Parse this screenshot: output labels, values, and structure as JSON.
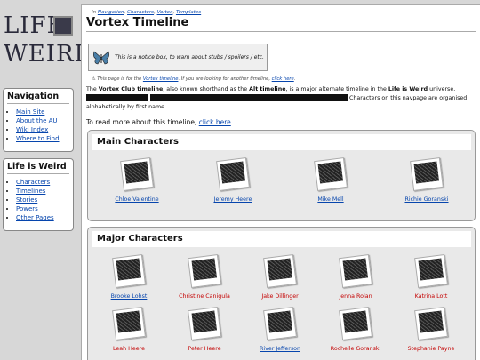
{
  "logo": {
    "line1": "LIFE",
    "line2": "WEIRD"
  },
  "nav": {
    "title": "Navigation",
    "items": [
      "Main Site",
      "About the AU",
      "Wiki Index",
      "Where to Find"
    ]
  },
  "liw": {
    "title": "Life is Weird",
    "items": [
      "Characters",
      "Timelines",
      "Stories",
      "Powers",
      "Other Pages"
    ]
  },
  "breadcrumb": {
    "prefix": "In",
    "links": [
      "Navigation",
      "Characters",
      "Vortex",
      "Templates"
    ]
  },
  "page": {
    "title": "Vortex Timeline"
  },
  "notice": {
    "text": "This is a notice box, to warn about stubs / spoilers / etc."
  },
  "hatnote": {
    "before": "⚠ This page is for the",
    "link1": "Vortex timeline",
    "middle": ". If you are looking for another timeline,",
    "link2": "click here",
    "after": "."
  },
  "intro": {
    "p1": "The",
    "b1": "Vortex Club timeline",
    "p2": ", also known shorthand as the",
    "b2": "Alt timeline",
    "p3": ", is a major alternate timeline in the",
    "b3": "Life is Weird",
    "p4": "universe.",
    "p5": "Characters on this navpage are organised alphabetically by first name."
  },
  "intro2": {
    "text": "To read more about this timeline,",
    "link": "click here",
    "end": "."
  },
  "main_characters": {
    "title": "Main Characters",
    "items": [
      {
        "name": "Chloe Valentine",
        "link": true
      },
      {
        "name": "Jeremy Heere",
        "link": true
      },
      {
        "name": "Mike Mell",
        "link": true
      },
      {
        "name": "Richie Goranski",
        "link": true
      }
    ]
  },
  "major_characters": {
    "title": "Major Characters",
    "items": [
      {
        "name": "Brooke Lohst",
        "link": true
      },
      {
        "name": "Christine Canigula",
        "link": false
      },
      {
        "name": "Jake Dillinger",
        "link": false
      },
      {
        "name": "Jenna Rolan",
        "link": false
      },
      {
        "name": "Katrina Lott",
        "link": false
      },
      {
        "name": "Leah Heere",
        "link": false
      },
      {
        "name": "Peter Heere",
        "link": false
      },
      {
        "name": "River Jefferson",
        "link": true
      },
      {
        "name": "Rochelle Goranski",
        "link": false
      },
      {
        "name": "Stephanie Payne",
        "link": false
      }
    ]
  },
  "colors": {
    "link": "#0645ad",
    "redlink": "#c40000",
    "accent": "#2a2a3a"
  }
}
